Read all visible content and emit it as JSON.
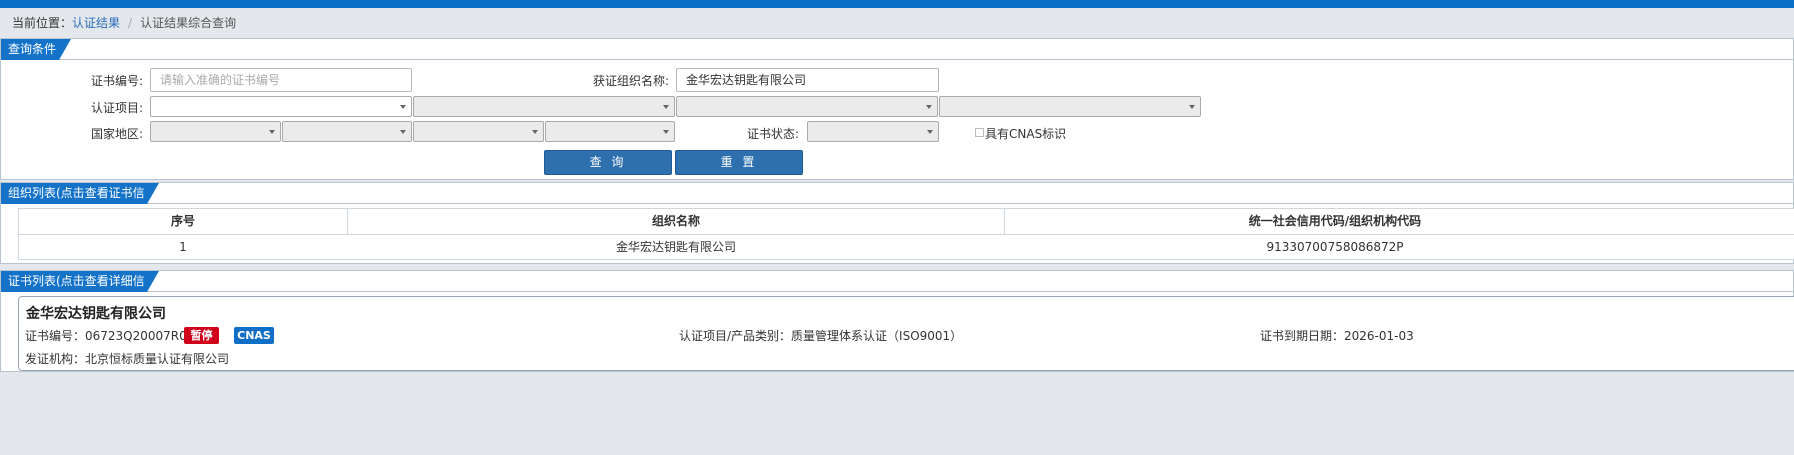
{
  "breadcrumb": {
    "label": "当前位置：",
    "link": "认证结果",
    "separator": "/",
    "current": "认证结果综合查询"
  },
  "query_panel": {
    "title": "查询条件",
    "cert_no_label": "证书编号:",
    "cert_no_placeholder": "请输入准确的证书编号",
    "org_name_label": "获证组织名称:",
    "org_name_value": "金华宏达钥匙有限公司",
    "cert_project_label": "认证项目:",
    "region_label": "国家地区:",
    "cert_status_label": "证书状态:",
    "cnas_checkbox_label": "具有CNAS标识",
    "search_button": "查 询",
    "reset_button": "重 置"
  },
  "org_list": {
    "title": "组织列表(点击查看证书信息)",
    "columns": [
      "序号",
      "组织名称",
      "统一社会信用代码/组织机构代码"
    ],
    "rows": [
      [
        "1",
        "金华宏达钥匙有限公司",
        "91330700758086872P"
      ]
    ]
  },
  "cert_list": {
    "title": "证书列表(点击查看详细信息)",
    "cards": [
      {
        "org_name": "金华宏达钥匙有限公司",
        "cert_no": "证书编号：06723Q20007R0S",
        "status_badge": "暂停",
        "cnas_badge": "CNAS",
        "project": "认证项目/产品类别：质量管理体系认证（ISO9001）",
        "expiry": "证书到期日期：2026-01-03",
        "issuer": "发证机构：北京恒标质量认证有限公司"
      }
    ]
  },
  "colors": {
    "brand_blue": "#0a6fc9",
    "tab_blue": "#1473c9",
    "button_blue": "#2e6fae",
    "suspend_red": "#d0021b",
    "cnas_blue": "#0f6fc6",
    "background": "#e4e8ec"
  }
}
